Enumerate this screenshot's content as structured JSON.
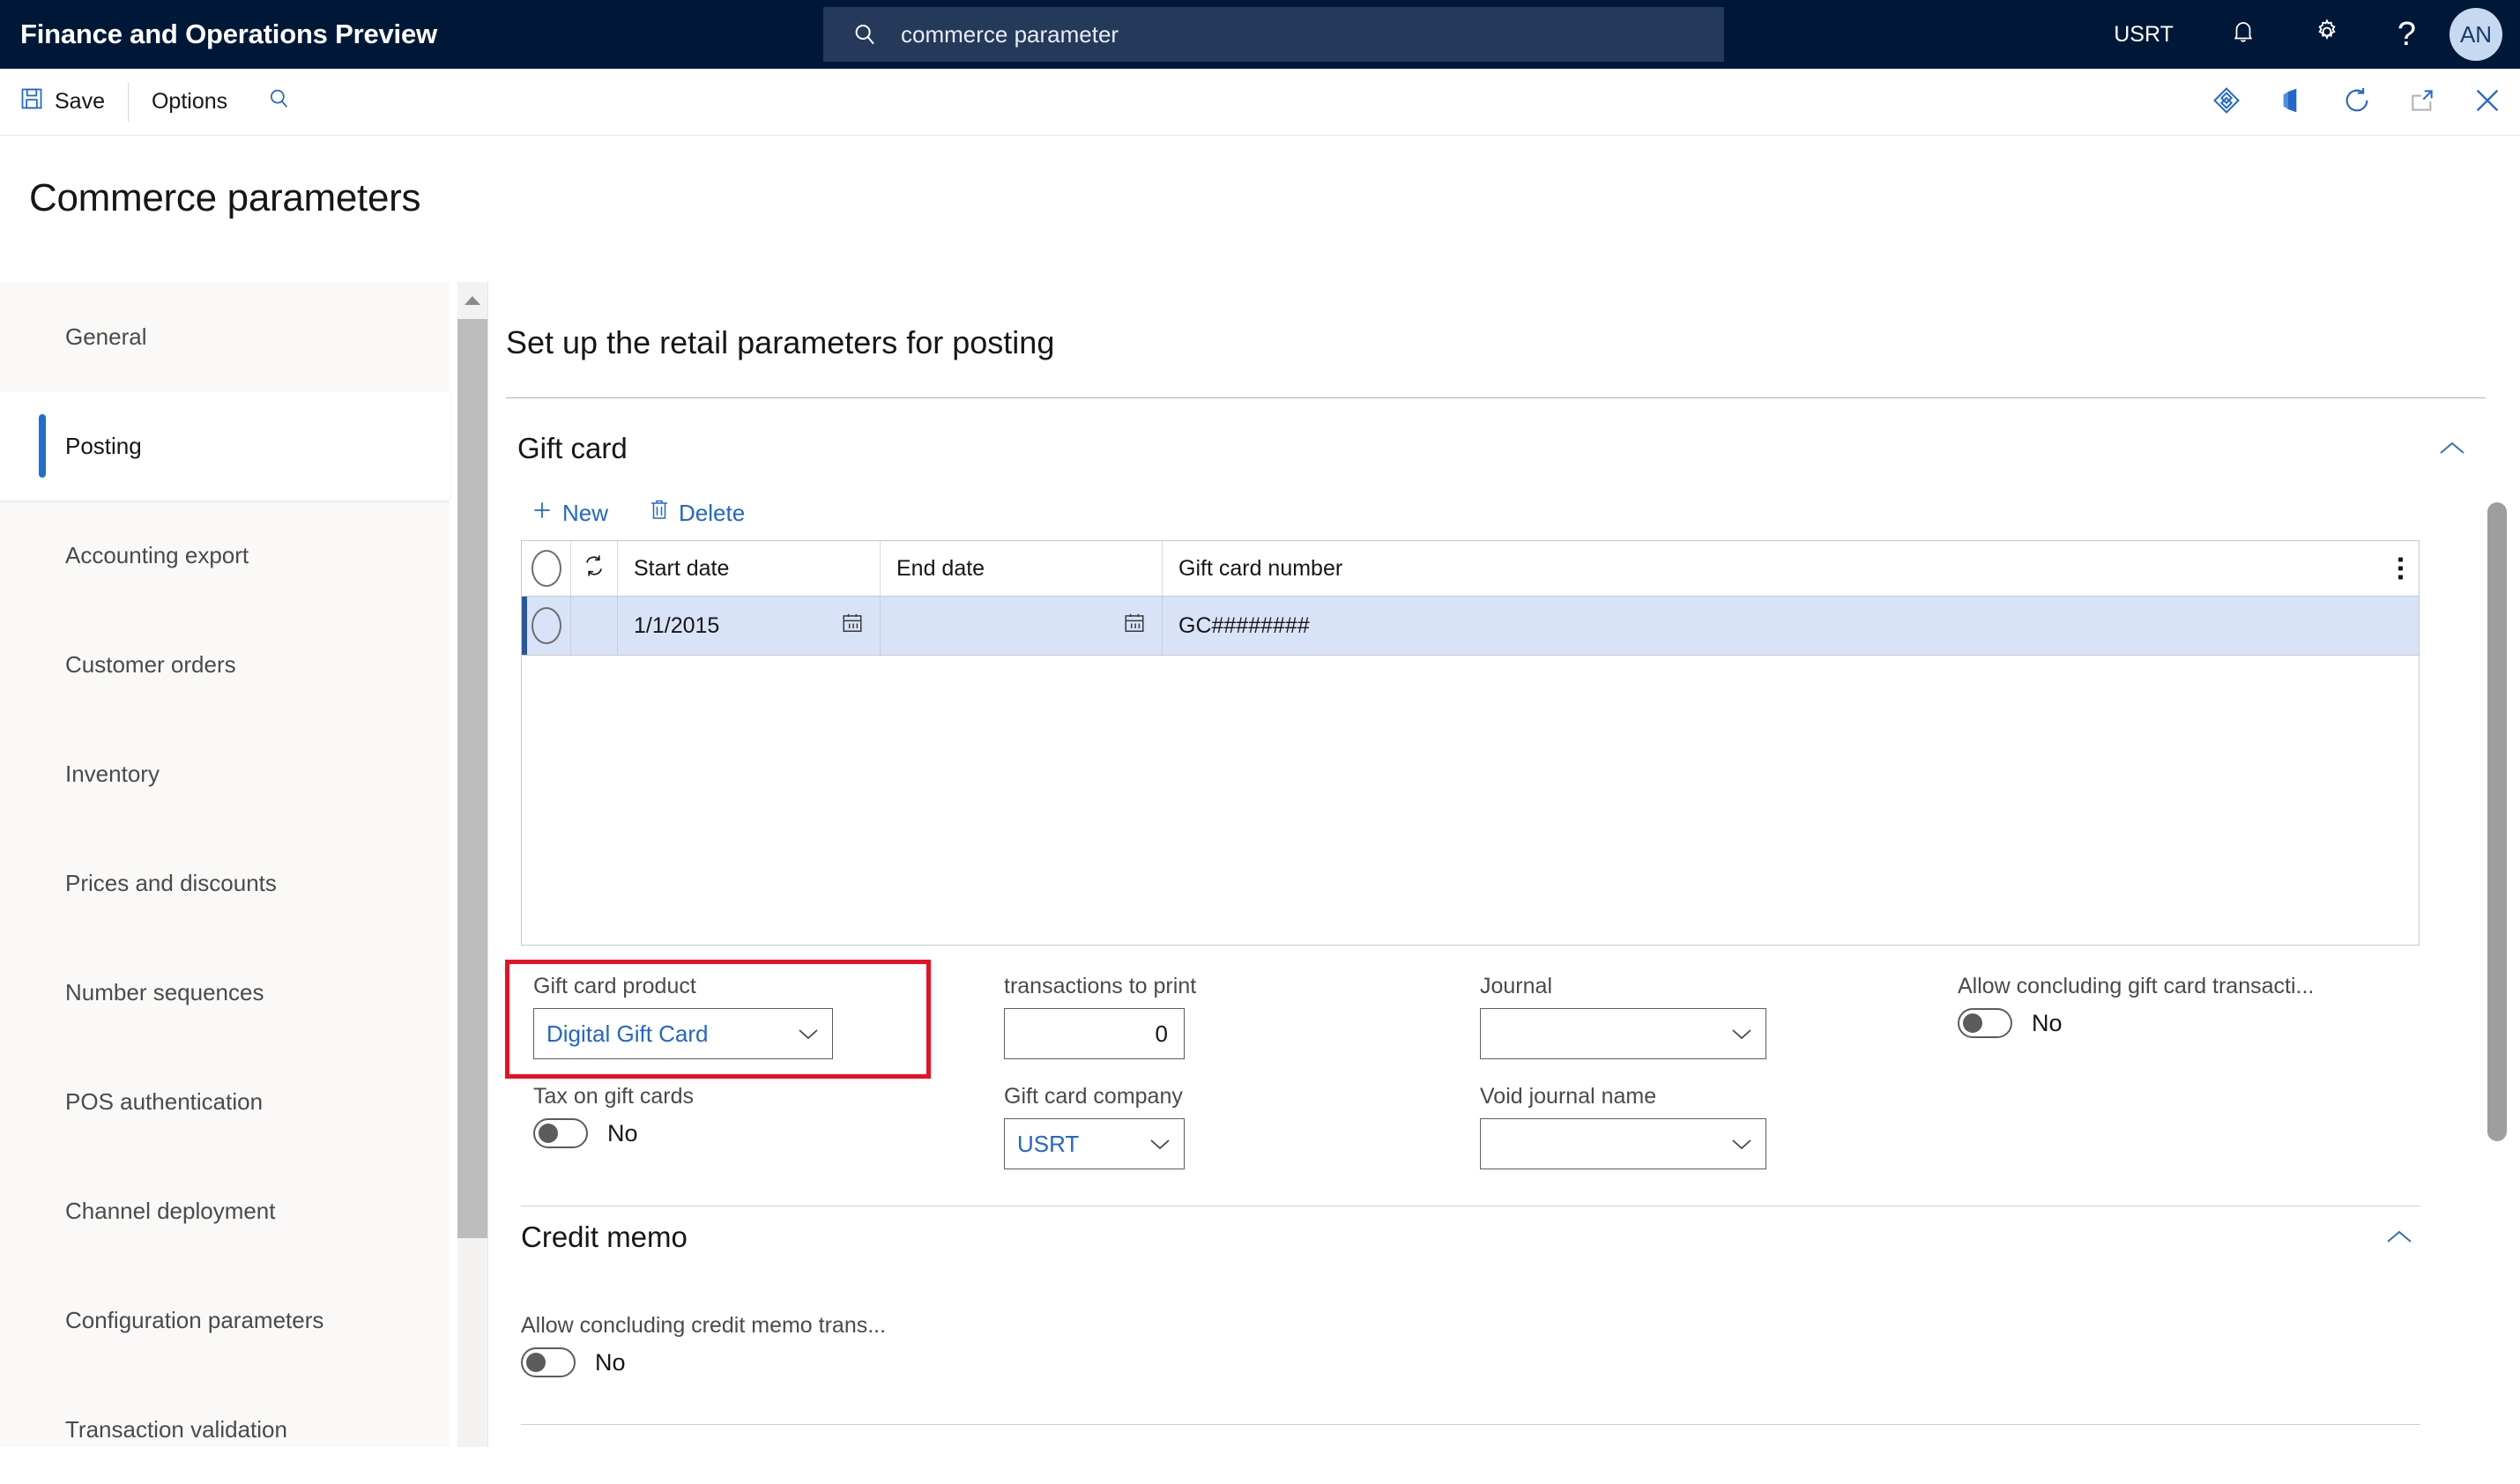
{
  "topbar": {
    "app_title": "Finance and Operations Preview",
    "search": {
      "icon": "search-icon",
      "value": "commerce parameter",
      "placeholder": "Search for a page"
    },
    "company": "USRT",
    "notifications_icon": "bell-icon",
    "settings_icon": "gear-icon",
    "help_icon": "question-mark-icon",
    "avatar_initials": "AN"
  },
  "toolbar": {
    "save_label": "Save",
    "save_icon": "save-disk-icon",
    "options_label": "Options",
    "search_icon": "magnifier-icon",
    "right_icons": [
      {
        "name": "power-bi-icon"
      },
      {
        "name": "office-icon"
      },
      {
        "name": "refresh-icon"
      },
      {
        "name": "open-in-new-window-icon"
      },
      {
        "name": "close-icon"
      }
    ]
  },
  "page": {
    "title": "Commerce parameters"
  },
  "sidebar": {
    "items": [
      {
        "label": "General",
        "selected": false
      },
      {
        "label": "Posting",
        "selected": true
      },
      {
        "label": "Accounting export",
        "selected": false
      },
      {
        "label": "Customer orders",
        "selected": false
      },
      {
        "label": "Inventory",
        "selected": false
      },
      {
        "label": "Prices and discounts",
        "selected": false
      },
      {
        "label": "Number sequences",
        "selected": false
      },
      {
        "label": "POS authentication",
        "selected": false
      },
      {
        "label": "Channel deployment",
        "selected": false
      },
      {
        "label": "Configuration parameters",
        "selected": false
      },
      {
        "label": "Transaction validation",
        "selected": false
      }
    ],
    "scroll_up_icon": "triangle-up-icon"
  },
  "main": {
    "title": "Set up the retail parameters for posting",
    "sections": [
      {
        "title": "Gift card",
        "collapse_icon": "chevron-up-icon"
      },
      {
        "title": "Credit memo",
        "collapse_icon": "chevron-up-icon"
      }
    ],
    "grid_toolbar": {
      "new_label": "New",
      "new_icon": "plus-icon",
      "delete_label": "Delete",
      "delete_icon": "trash-icon"
    },
    "grid": {
      "columns": [
        "",
        "",
        "Start date",
        "End date",
        "Gift card number"
      ],
      "select_all_icon": "radio-circle-icon",
      "refresh_icon": "circular-arrows-icon",
      "overflow_icon": "more-vertical-icon",
      "rows": [
        {
          "selected": true,
          "row_select_icon": "radio-circle-icon",
          "start_date": "1/1/2015",
          "start_date_icon": "calendar-icon",
          "end_date": "",
          "end_date_icon": "calendar-icon",
          "gift_card_number": "GC########"
        }
      ]
    },
    "fields": {
      "gift_card_product": {
        "label": "Gift card product",
        "value": "Digital Gift Card",
        "caret_icon": "chevron-down-icon",
        "highlighted": true
      },
      "tax_on_gift_cards": {
        "label": "Tax on gift cards",
        "value": "No"
      },
      "transactions_to_print": {
        "label": "transactions to print",
        "value": "0"
      },
      "gift_card_company": {
        "label": "Gift card company",
        "value": "USRT",
        "caret_icon": "chevron-down-icon"
      },
      "journal": {
        "label": "Journal",
        "value": "",
        "caret_icon": "chevron-down-icon"
      },
      "void_journal_name": {
        "label": "Void journal name",
        "value": "",
        "caret_icon": "chevron-down-icon"
      },
      "allow_concluding_gift_card": {
        "label": "Allow concluding gift card transacti...",
        "value": "No"
      },
      "allow_concluding_credit_memo": {
        "label": "Allow concluding credit memo trans...",
        "value": "No"
      }
    }
  },
  "colors": {
    "header_bg": "#001838",
    "search_bg": "#25395b",
    "accent_blue": "#2266cc",
    "selected_row": "#d9e3f7",
    "highlight_red": "#e81123",
    "nav_bg": "#faf9f8"
  }
}
